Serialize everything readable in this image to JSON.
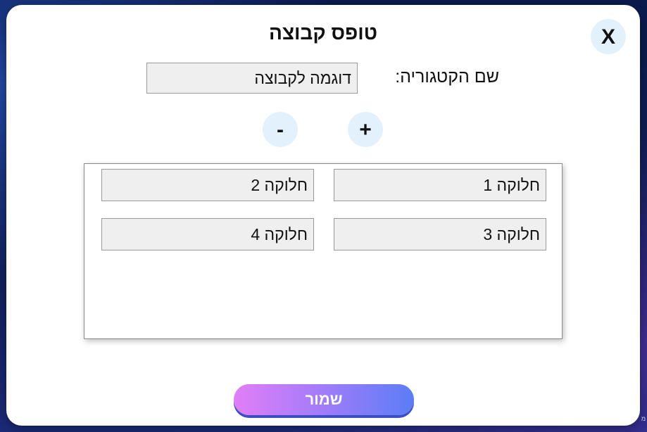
{
  "background": {
    "title": "",
    "corner_text": "מ"
  },
  "modal": {
    "title": "טופס קבוצה",
    "close_label": "X",
    "category_label": "שם הקטגוריה:",
    "category_value": "דוגמה לקבוצה",
    "minus_label": "-",
    "plus_label": "+",
    "groups": [
      "חלוקה 1",
      "חלוקה 2",
      "חלוקה 3",
      "חלוקה 4"
    ],
    "save_label": "שמור"
  },
  "colors": {
    "accent_light": "#e3f1fd",
    "save_gradient_start": "#e27ef7",
    "save_gradient_end": "#5b7df7",
    "input_bg": "#efefef"
  }
}
